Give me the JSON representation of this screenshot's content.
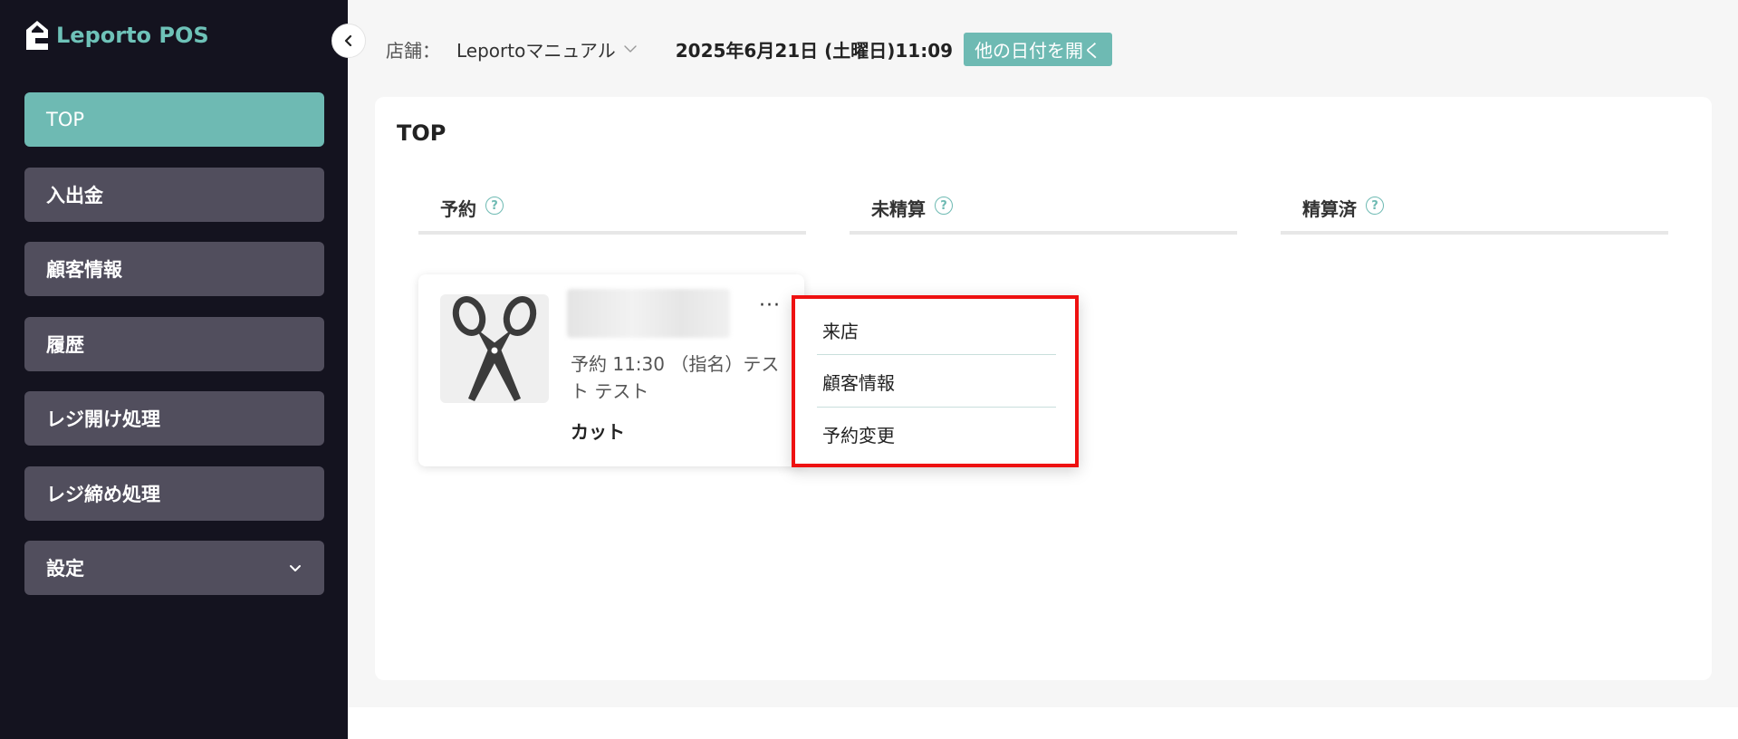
{
  "app": {
    "title": "Leporto POS"
  },
  "sidebar": {
    "items": [
      {
        "label": "TOP"
      },
      {
        "label": "入出金"
      },
      {
        "label": "顧客情報"
      },
      {
        "label": "履歴"
      },
      {
        "label": "レジ開け処理"
      },
      {
        "label": "レジ締め処理"
      },
      {
        "label": "設定"
      }
    ]
  },
  "header": {
    "store_label": "店舗：",
    "store_value": "Leportoマニュアル",
    "date": "2025年6月21日 (土曜日)11:09",
    "open_date_button": "他の日付を開く"
  },
  "main": {
    "title": "TOP",
    "columns": [
      {
        "label": "予約",
        "help": "?"
      },
      {
        "label": "未精算",
        "help": "?"
      },
      {
        "label": "精算済",
        "help": "?"
      }
    ],
    "reservation": {
      "more": "···",
      "time_text": "予約 11:30 （指名）テスト テスト",
      "service": "カット"
    },
    "menu": [
      {
        "label": "来店"
      },
      {
        "label": "顧客情報"
      },
      {
        "label": "予約変更"
      }
    ]
  },
  "colors": {
    "sidebar_bg": "#14131f",
    "nav_item_bg": "#514e5d",
    "accent": "#6ebab3",
    "highlight": "#ee1111"
  },
  "icons": {
    "logo": "house-logo-icon",
    "collapse": "chevron-left-icon",
    "settings_expand": "chevron-down-icon",
    "store_dropdown": "chevron-down-icon",
    "help": "question-circle-icon",
    "thumbnail": "scissors-icon",
    "more": "more-horizontal-icon"
  }
}
